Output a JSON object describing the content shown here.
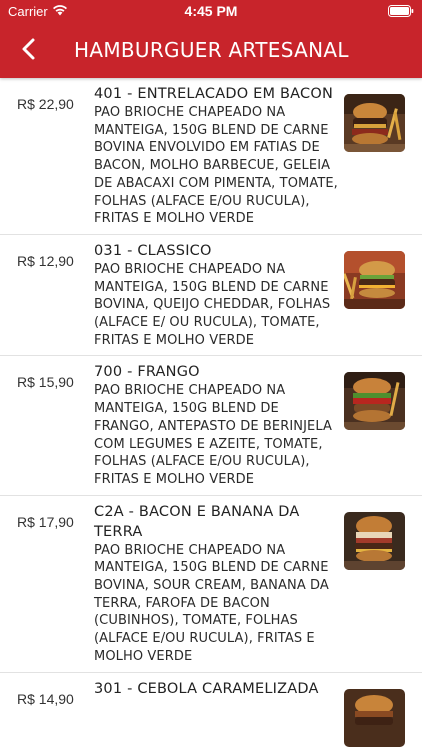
{
  "status_bar": {
    "carrier": "Carrier",
    "time": "4:45 PM"
  },
  "header": {
    "title": "HAMBURGUER ARTESANAL",
    "back_icon": "chevron-left-icon",
    "background_color": "#c8242b"
  },
  "items": [
    {
      "price": "R$ 22,90",
      "name": "401 - ENTRELACADO EM BACON",
      "description": "PAO BRIOCHE CHAPEADO NA MANTEIGA, 150G BLEND DE CARNE BOVINA ENVOLVIDO EM FATIAS DE BACON, MOLHO BARBECUE, GELEIA DE ABACAXI COM PIMENTA, TOMATE, FOLHAS (ALFACE E/OU RUCULA), FRITAS E MOLHO VERDE"
    },
    {
      "price": "R$ 12,90",
      "name": "031 - CLASSICO",
      "description": "PAO BRIOCHE CHAPEADO NA MANTEIGA, 150G BLEND DE CARNE BOVINA, QUEIJO CHEDDAR, FOLHAS (ALFACE E/ OU RUCULA), TOMATE, FRITAS E MOLHO VERDE"
    },
    {
      "price": "R$ 15,90",
      "name": "700 - FRANGO",
      "description": "PAO BRIOCHE CHAPEADO NA MANTEIGA, 150G BLEND DE FRANGO, ANTEPASTO DE BERINJELA COM LEGUMES E AZEITE, TOMATE, FOLHAS (ALFACE E/OU RUCULA), FRITAS E MOLHO VERDE"
    },
    {
      "price": "R$ 17,90",
      "name": "C2A - BACON E BANANA DA TERRA",
      "description": "PAO BRIOCHE CHAPEADO NA MANTEIGA, 150G BLEND DE CARNE BOVINA, SOUR CREAM, BANANA DA TERRA, FAROFA DE BACON (CUBINHOS), TOMATE, FOLHAS (ALFACE E/OU RUCULA), FRITAS E MOLHO VERDE"
    },
    {
      "price": "R$ 14,90",
      "name": "301 - CEBOLA CARAMELIZADA",
      "description": ""
    }
  ]
}
